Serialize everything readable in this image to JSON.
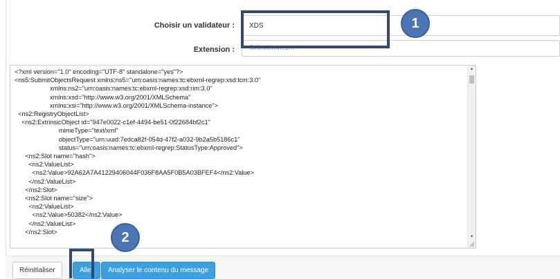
{
  "form": {
    "validator_label": "Choisir un validateur :",
    "validator_value": "XDS",
    "extension_label": "Extension :",
    "extension_placeholder": "Sélectionnez..."
  },
  "annotations": {
    "badge_1": "1",
    "badge_2": "2",
    "highlight_color": "#2f4a74",
    "badge_color": "#4c75b5"
  },
  "message": {
    "xml_content": "<?xml version=\"1.0\" encoding=\"UTF-8\" standalone=\"yes\"?>\n<ns5:SubmitObjectsRequest xmlns:ns5=\"urn:oasis:names:tc:ebxml-regrep:xsd:lcm:3.0\"\n                    xmlns:ns2=\"urn:oasis:names:tc:ebxml-regrep:xsd:rim:3.0\"\n                    xmlns:xsd=\"http://www.w3.org/2001/XMLSchema\"\n                    xmlns:xsi=\"http://www.w3.org/2001/XMLSchema-instance\">\n  <ns2:RegistryObjectList>\n    <ns2:ExtrinsicObject id=\"947e0022-c1ef-4494-be51-0f22684bf2c1\"\n                         mimeType=\"text/xml\"\n                         objectType=\"urn:uuid:7edca82f-054d-47f2-a032-9b2a5b5186c1\"\n                         status=\"urn:oasis:names:tc:ebxml-regrep:StatusType:Approved\">\n      <ns2:Slot name=\"hash\">\n        <ns2:ValueList>\n          <ns2:Value>92A62A7A41229406044F036F8AA5F0B5A03BFEF4</ns2:Value>\n        </ns2:ValueList>\n      </ns2:Slot>\n      <ns2:Slot name=\"size\">\n        <ns2:ValueList>\n          <ns2:Value>50382</ns2:Value>\n        </ns2:ValueList>\n      </ns2:Slot>"
  },
  "footer": {
    "reset_label": "Réinitialiser",
    "go_label": "Aller",
    "analyze_label": "Analyser le contenu du message"
  },
  "colors": {
    "primary_button": "#3c9fe0",
    "footer_background": "#f5f5f5"
  }
}
